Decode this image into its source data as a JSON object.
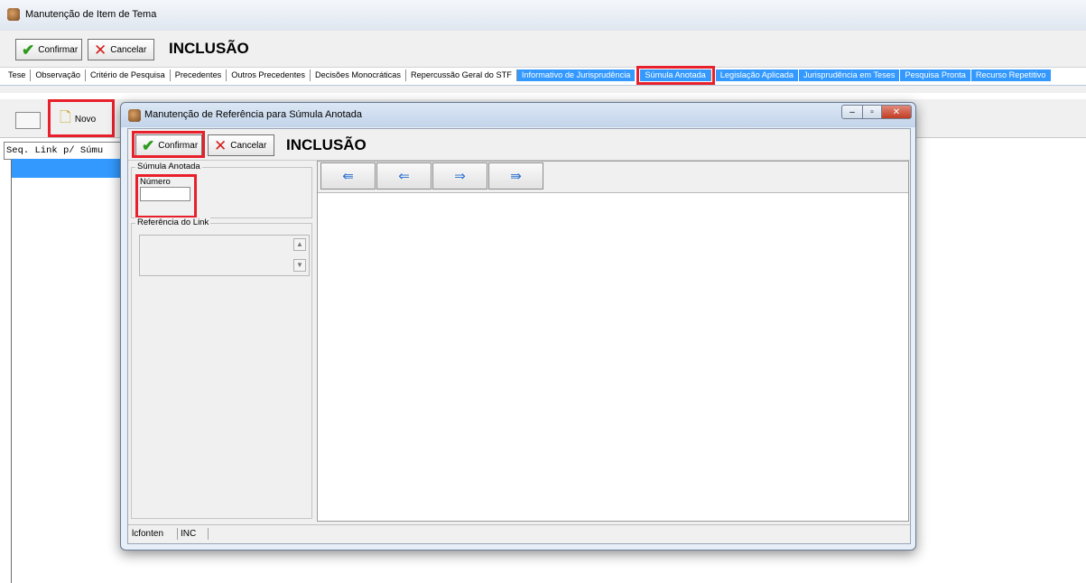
{
  "main_window": {
    "title": "Manutenção de Item de Tema",
    "toolbar": {
      "confirm_label": "Confirmar",
      "cancel_label": "Cancelar",
      "mode_label": "INCLUSÃO"
    },
    "tabs": [
      {
        "label": "Tese"
      },
      {
        "label": "Observação"
      },
      {
        "label": "Critério de Pesquisa"
      },
      {
        "label": "Precedentes"
      },
      {
        "label": "Outros Precedentes"
      },
      {
        "label": "Decisões Monocráticas"
      },
      {
        "label": "Repercussão Geral do STF"
      },
      {
        "label": "Informativo de Jurisprudência"
      },
      {
        "label": "Súmula Anotada"
      },
      {
        "label": "Legislação Aplicada"
      },
      {
        "label": "Jurisprudência em Teses"
      },
      {
        "label": "Pesquisa Pronta"
      },
      {
        "label": "Recurso Repetitivo"
      }
    ],
    "selected_tab": "Súmula Anotada",
    "panel": {
      "new_label": "Novo",
      "grid_header": "Seq. Link p/ Súmu"
    }
  },
  "dialog": {
    "title": "Manutenção de Referência para Súmula Anotada",
    "toolbar": {
      "confirm_label": "Confirmar",
      "cancel_label": "Cancelar",
      "mode_label": "INCLUSÃO"
    },
    "sumula_group": {
      "label": "Súmula Anotada",
      "numero_label": "Número",
      "numero_value": ""
    },
    "referencia_group": {
      "label": "Referência do Link",
      "value": ""
    },
    "nav_buttons": [
      {
        "icon": "first-arrow-icon",
        "glyph": "⇚"
      },
      {
        "icon": "prev-arrow-icon",
        "glyph": "⇐"
      },
      {
        "icon": "next-arrow-icon",
        "glyph": "⇒"
      },
      {
        "icon": "last-arrow-icon",
        "glyph": "⇛"
      }
    ],
    "statusbar": {
      "user": "lcfonten",
      "mode": "INC"
    }
  },
  "colors": {
    "tab_highlight": "#3399ff",
    "annotation_red": "#e8202c",
    "confirm_green": "#2e9b1c",
    "cancel_red": "#d21f1f"
  }
}
